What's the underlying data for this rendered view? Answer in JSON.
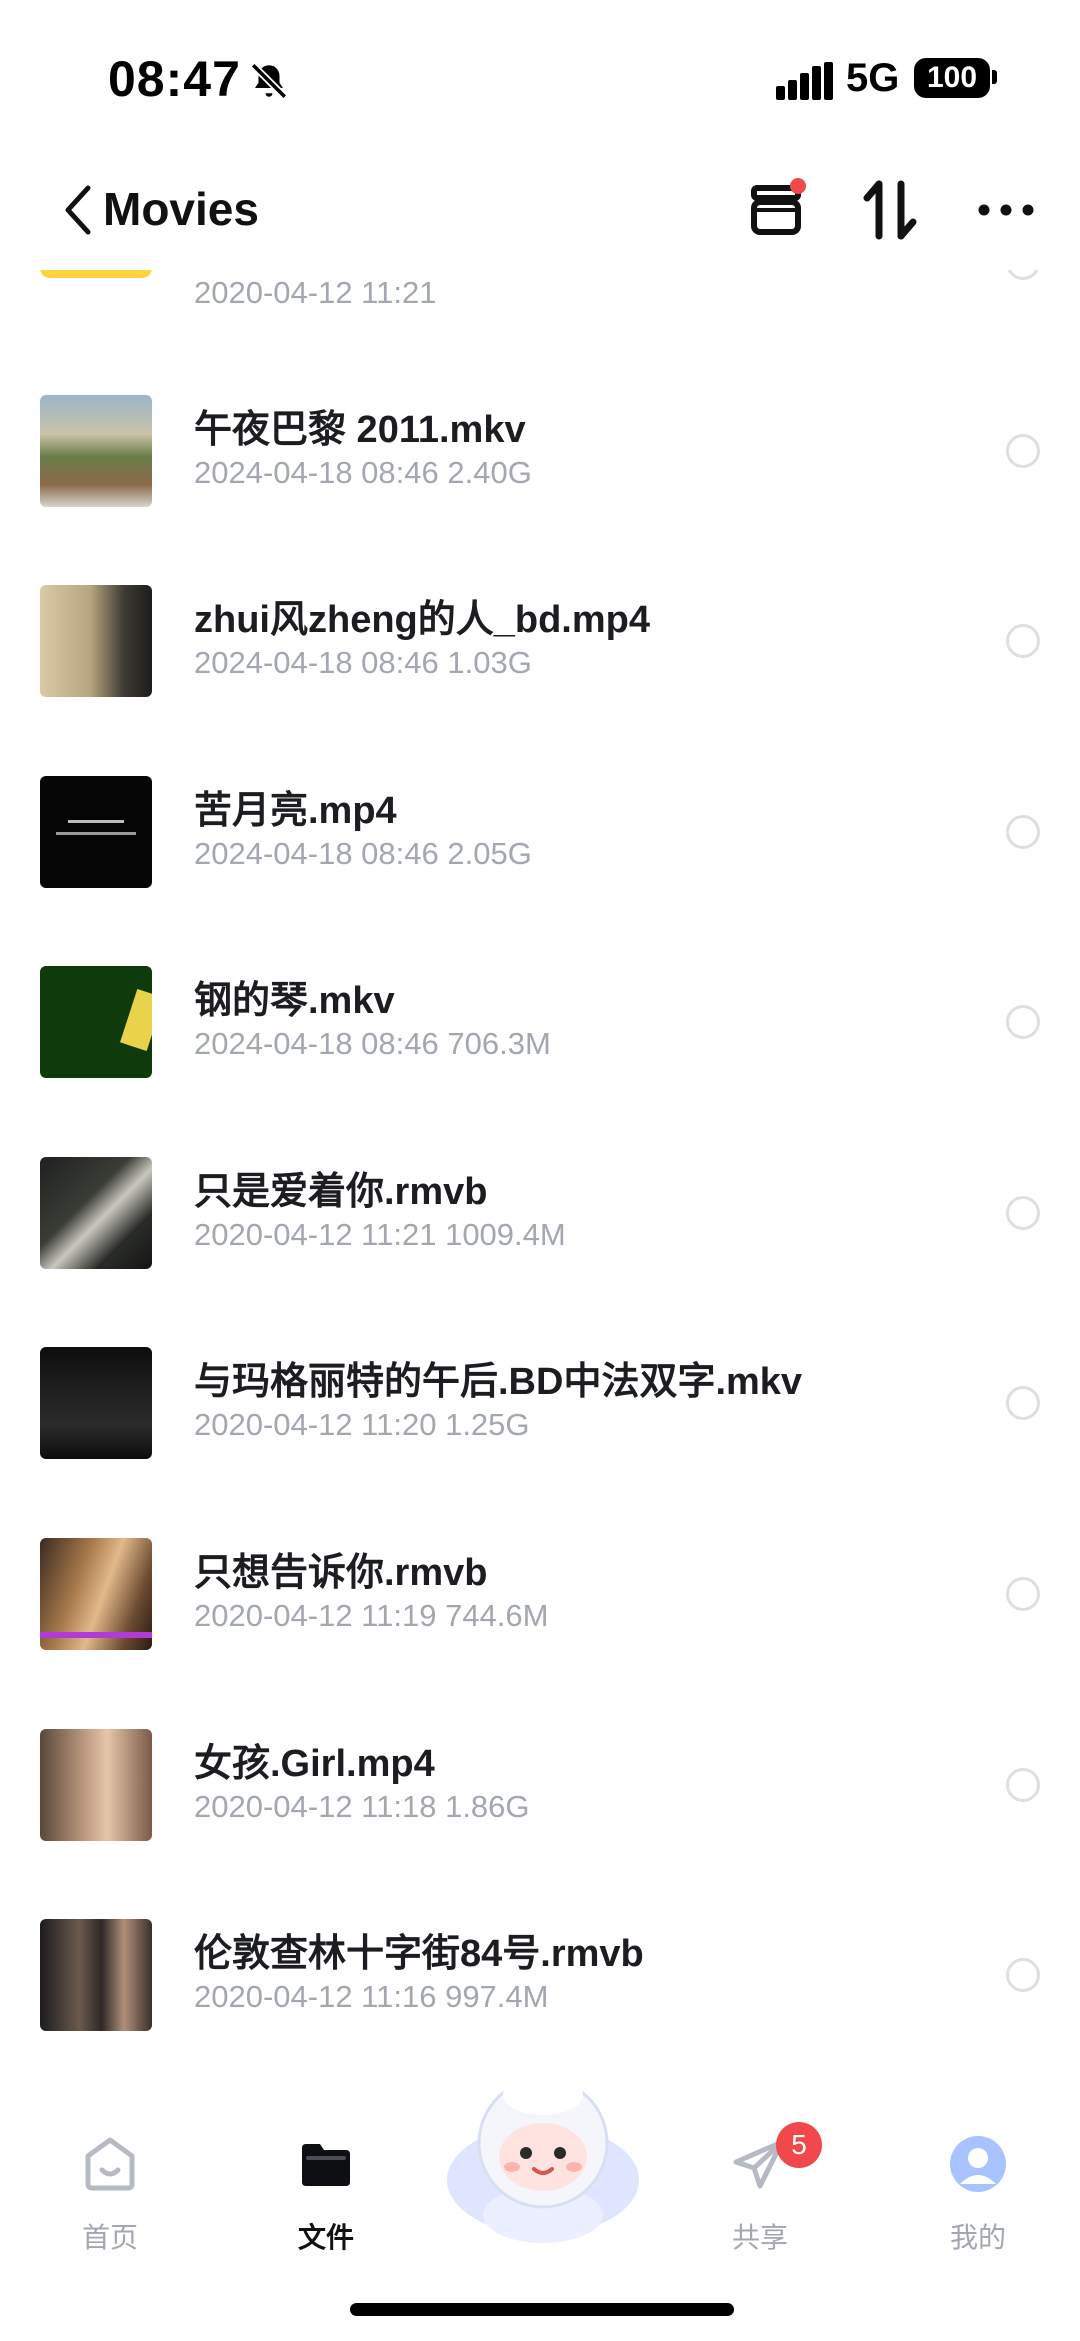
{
  "status_bar": {
    "time": "08:47",
    "network": "5G",
    "battery": "100"
  },
  "header": {
    "title": "Movies"
  },
  "files": [
    {
      "name": "",
      "meta": "2020-04-12 11:21",
      "thumb": "folder-yellow"
    },
    {
      "name": "午夜巴黎 2011.mkv",
      "meta": "2024-04-18 08:46   2.40G",
      "thumb": "street-scene"
    },
    {
      "name": "zhui风zheng的人_bd.mp4",
      "meta": "2024-04-18 08:46   1.03G",
      "thumb": "dim-interior"
    },
    {
      "name": "苦月亮.mp4",
      "meta": "2024-04-18 08:46   2.05G",
      "thumb": "black-text-card"
    },
    {
      "name": "钢的琴.mkv",
      "meta": "2024-04-18 08:46   706.3M",
      "thumb": "green-sign"
    },
    {
      "name": "只是爱着你.rmvb",
      "meta": "2020-04-12 11:21   1009.4M",
      "thumb": "hands-paper"
    },
    {
      "name": "与玛格丽特的午后.BD中法双字.mkv",
      "meta": "2020-04-12 11:20   1.25G",
      "thumb": "dark-scene"
    },
    {
      "name": "只想告诉你.rmvb",
      "meta": "2020-04-12 11:19   744.6M",
      "thumb": "warm-closeup"
    },
    {
      "name": "女孩.Girl.mp4",
      "meta": "2020-04-12 11:18   1.86G",
      "thumb": "girl-portrait"
    },
    {
      "name": "伦敦查林十字街84号.rmvb",
      "meta": "2020-04-12 11:16   997.4M",
      "thumb": "two-people"
    }
  ],
  "nav": {
    "home": "首页",
    "files": "文件",
    "share": "共享",
    "share_badge": "5",
    "mine": "我的"
  },
  "colors": {
    "accent_badge": "#f0484b",
    "folder": "#ffd43b",
    "muted_text": "#a3a7b0"
  }
}
